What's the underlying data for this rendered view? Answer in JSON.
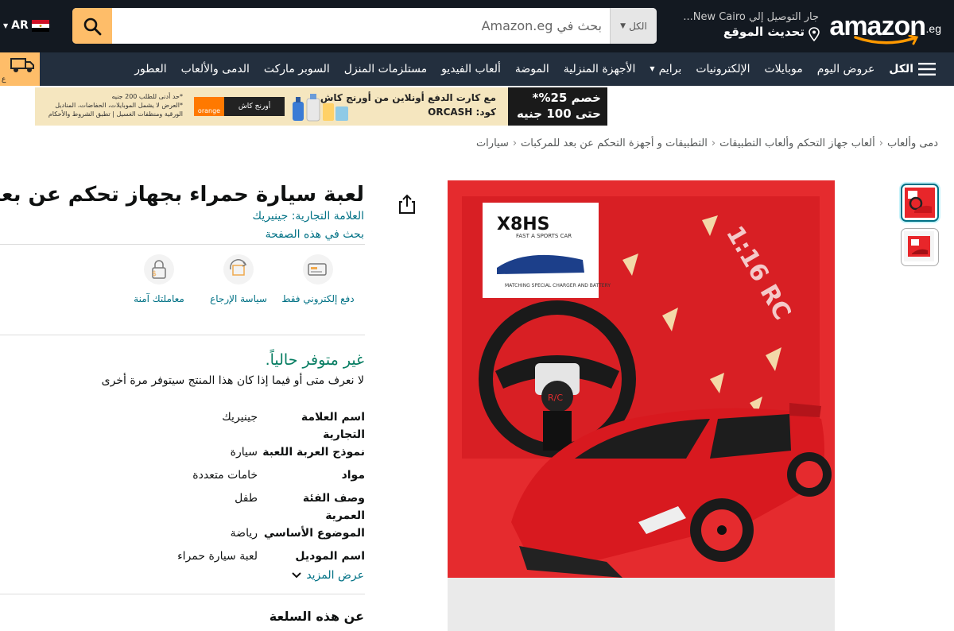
{
  "header": {
    "logo_text": "amazon",
    "logo_suffix": ".eg",
    "deliver_line1": "جار التوصيل إلي New Cairo...",
    "deliver_line2": "تحديث الموقع",
    "search_category": "الكل",
    "search_placeholder": "بحث في Amazon.eg",
    "language": "AR",
    "colors": {
      "topbar": "#131921",
      "navbar": "#232f3e",
      "search_button": "#febd69"
    }
  },
  "nav": {
    "all_label": "الكل",
    "items": [
      "عروض اليوم",
      "موبايلات",
      "الإلكترونيات",
      "برايم",
      "الأجهزة المنزلية",
      "الموضة",
      "ألعاب الفيديو",
      "مستلزمات المنزل",
      "السوبر ماركت",
      "الدمى والألعاب",
      "العطور"
    ]
  },
  "banner": {
    "discount_line1": "خصم 25%*",
    "discount_line2": "حتى 100 جنيه",
    "offer_line1": "مع كارت الدفع أونلاين من أورنج كاش",
    "offer_code": "كود: ORCASH",
    "fine_print1": "*حد أدنى للطلب 200 جنيه",
    "fine_print2": "*العرض لا يشمل الموبايلات، الحفاضات، المناديل الورقية ومنظفات الغسيل | تطبق الشروط والأحكام",
    "logo_label": "أورنج كاش",
    "logo_brand": "orange"
  },
  "breadcrumb": [
    "دمى وألعاب",
    "ألعاب جهاز التحكم وألعاب التطبيقات",
    "التطبيقات و أجهزة التحكم عن بعد للمركبات",
    "سيارات"
  ],
  "product": {
    "title": "لعبة سيارة حمراء بجهاز تحكم عن بعد",
    "brand_line": "العلامة التجارية: جينيريك",
    "search_page": "بحث في هذه الصفحة",
    "features": [
      {
        "label": "دفع إلكتروني فقط",
        "icon": "card-icon"
      },
      {
        "label": "سياسة الإرجاع",
        "icon": "return-box-icon"
      },
      {
        "label": "معاملتك آمنة",
        "icon": "lock-icon"
      }
    ],
    "availability": "غير متوفر حالياً.",
    "availability_note": "لا نعرف متى أو فيما إذا كان هذا المنتج سيتوفر مرة أخرى",
    "specs": [
      {
        "k": "اسم العلامة التجارية",
        "v": "جينيريك"
      },
      {
        "k": "نموذج العربة اللعبة",
        "v": "سيارة"
      },
      {
        "k": "مواد",
        "v": "خامات متعددة"
      },
      {
        "k": "وصف الفئة العمرية",
        "v": "طفل"
      },
      {
        "k": "الموضوع الأساسي",
        "v": "رياضة"
      },
      {
        "k": "اسم الموديل",
        "v": "لعبة سيارة حمراء"
      }
    ],
    "show_more": "عرض المزيد",
    "about_heading": "عن هذه السلعة",
    "image_box_text": "X8HS",
    "image_box_sub": "FAST A SPORTS CAR",
    "image_box_note": "MATCHING SPECIAL CHARGER AND BATTERY",
    "image_scale": "1:16 RC"
  }
}
